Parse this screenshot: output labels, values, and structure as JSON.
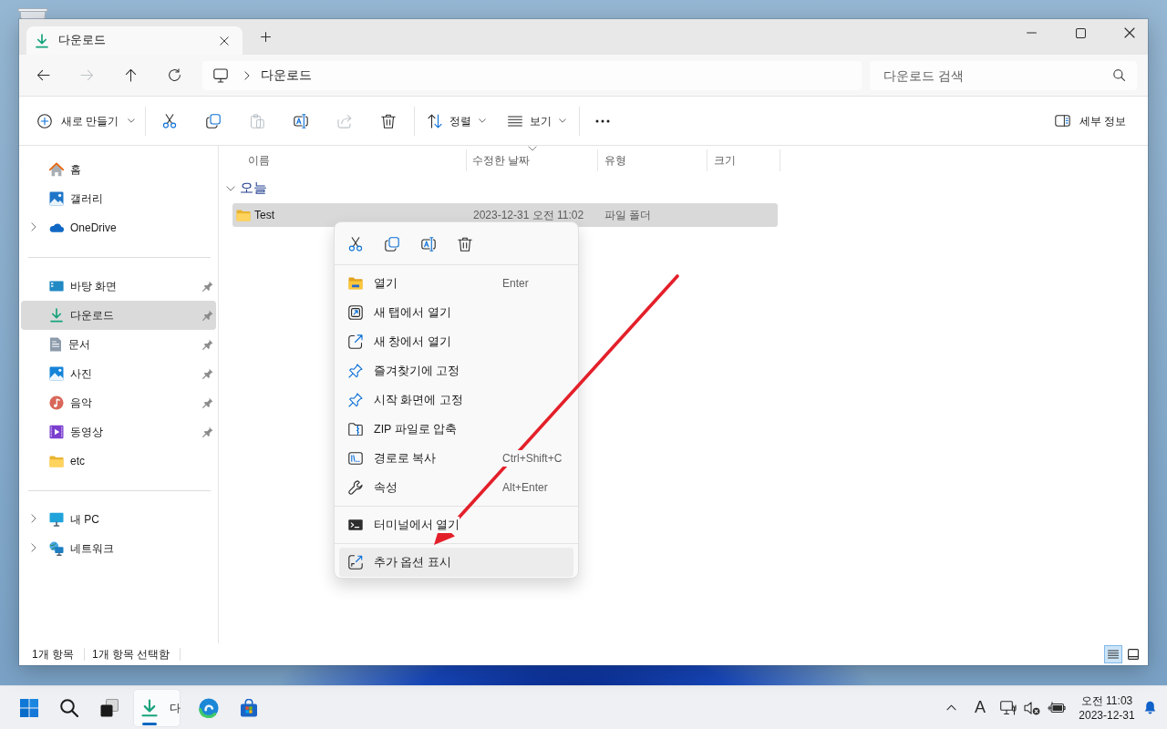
{
  "window": {
    "tabs": [
      {
        "kind": "download",
        "label": "다운로드",
        "selected": true
      }
    ]
  },
  "navigation": [
    {
      "kind": "back",
      "disabled": false
    },
    {
      "kind": "forward",
      "disabled": true
    },
    {
      "kind": "up",
      "disabled": false
    },
    {
      "kind": "refresh",
      "disabled": false
    }
  ],
  "address": {
    "path": [
      "다운로드"
    ]
  },
  "search": {
    "placeholder": "다운로드 검색"
  },
  "command_bar": {
    "new": "새로 만들기",
    "actions": [
      {
        "kind": "cut",
        "disabled": false
      },
      {
        "kind": "copy",
        "disabled": false
      },
      {
        "kind": "paste",
        "disabled": true
      },
      {
        "kind": "rename",
        "disabled": false
      },
      {
        "kind": "share",
        "disabled": true
      },
      {
        "kind": "delete",
        "disabled": false
      }
    ],
    "sort": "정렬",
    "view": "보기",
    "details": "세부 정보"
  },
  "sidebar": {
    "sections": [
      {
        "items": [
          {
            "kind": "home",
            "label": "홈",
            "expandable": false,
            "pinned": false,
            "selected": false
          },
          {
            "kind": "gallery",
            "label": "갤러리",
            "expandable": false,
            "pinned": false,
            "selected": false
          },
          {
            "kind": "cloud",
            "label": "OneDrive",
            "expandable": true,
            "pinned": false,
            "selected": false
          }
        ]
      },
      {
        "items": [
          {
            "kind": "desktop",
            "label": "바탕 화면",
            "expandable": false,
            "pinned": true,
            "selected": false
          },
          {
            "kind": "download",
            "label": "다운로드",
            "expandable": false,
            "pinned": true,
            "selected": true
          },
          {
            "kind": "documents",
            "label": "문서",
            "expandable": false,
            "pinned": true,
            "selected": false
          },
          {
            "kind": "pictures",
            "label": "사진",
            "expandable": false,
            "pinned": true,
            "selected": false
          },
          {
            "kind": "music",
            "label": "음악",
            "expandable": false,
            "pinned": true,
            "selected": false
          },
          {
            "kind": "videos",
            "label": "동영상",
            "expandable": false,
            "pinned": true,
            "selected": false
          },
          {
            "kind": "folder",
            "label": "etc",
            "expandable": false,
            "pinned": false,
            "selected": false
          }
        ]
      },
      {
        "items": [
          {
            "kind": "pc",
            "label": "내 PC",
            "expandable": true,
            "pinned": false,
            "selected": false
          },
          {
            "kind": "network",
            "label": "네트워크",
            "expandable": true,
            "pinned": false,
            "selected": false
          }
        ]
      }
    ]
  },
  "columns": [
    {
      "label": "이름",
      "sorted": false
    },
    {
      "label": "수정한 날짜",
      "sorted": true
    },
    {
      "label": "유형",
      "sorted": false
    },
    {
      "label": "크기",
      "sorted": false
    }
  ],
  "groups": [
    {
      "label": "오늘",
      "expanded": true,
      "rows": [
        {
          "kind": "folder",
          "name": "Test",
          "modified": "2023-12-31 오전 11:02",
          "type": "파일 폴더",
          "selected": true
        }
      ]
    }
  ],
  "status_bar": {
    "item_count": "1개 항목",
    "selection": "1개 항목 선택함",
    "views": [
      {
        "kind": "details",
        "selected": true
      },
      {
        "kind": "tiles",
        "selected": false
      }
    ]
  },
  "context_menu": {
    "quick_actions": [
      {
        "kind": "cut"
      },
      {
        "kind": "copy"
      },
      {
        "kind": "rename"
      },
      {
        "kind": "delete"
      }
    ],
    "sections": [
      {
        "items": [
          {
            "kind": "open",
            "label": "열기",
            "shortcut": "Enter",
            "selected": false
          },
          {
            "kind": "new_tab",
            "label": "새 탭에서 열기",
            "selected": false
          },
          {
            "kind": "new_window",
            "label": "새 창에서 열기",
            "selected": false
          },
          {
            "kind": "pin",
            "label": "즐겨찾기에 고정",
            "selected": false
          },
          {
            "kind": "pin",
            "label": "시작 화면에 고정",
            "selected": false
          },
          {
            "kind": "zip",
            "label": "ZIP 파일로 압축",
            "selected": false
          },
          {
            "kind": "copy_path",
            "label": "경로로 복사",
            "shortcut": "Ctrl+Shift+C",
            "selected": false
          },
          {
            "kind": "properties",
            "label": "속성",
            "shortcut": "Alt+Enter",
            "selected": false
          }
        ]
      },
      {
        "items": [
          {
            "kind": "terminal",
            "label": "터미널에서 열기",
            "selected": false
          }
        ]
      },
      {
        "items": [
          {
            "kind": "more_options",
            "label": "추가 옵션 표시",
            "selected": true
          }
        ]
      }
    ]
  },
  "taskbar": {
    "apps": [
      {
        "kind": "start",
        "selected": false
      },
      {
        "kind": "search",
        "selected": false
      },
      {
        "kind": "task_view",
        "selected": false
      },
      {
        "kind": "explorer",
        "label": "다",
        "selected": true
      },
      {
        "kind": "edge",
        "selected": false
      },
      {
        "kind": "store",
        "selected": false
      }
    ],
    "ime": "A",
    "tray": [
      {
        "kind": "network"
      },
      {
        "kind": "volume",
        "muted": true
      },
      {
        "kind": "battery"
      }
    ],
    "clock": {
      "time": "오전 11:03",
      "date": "2023-12-31"
    }
  }
}
